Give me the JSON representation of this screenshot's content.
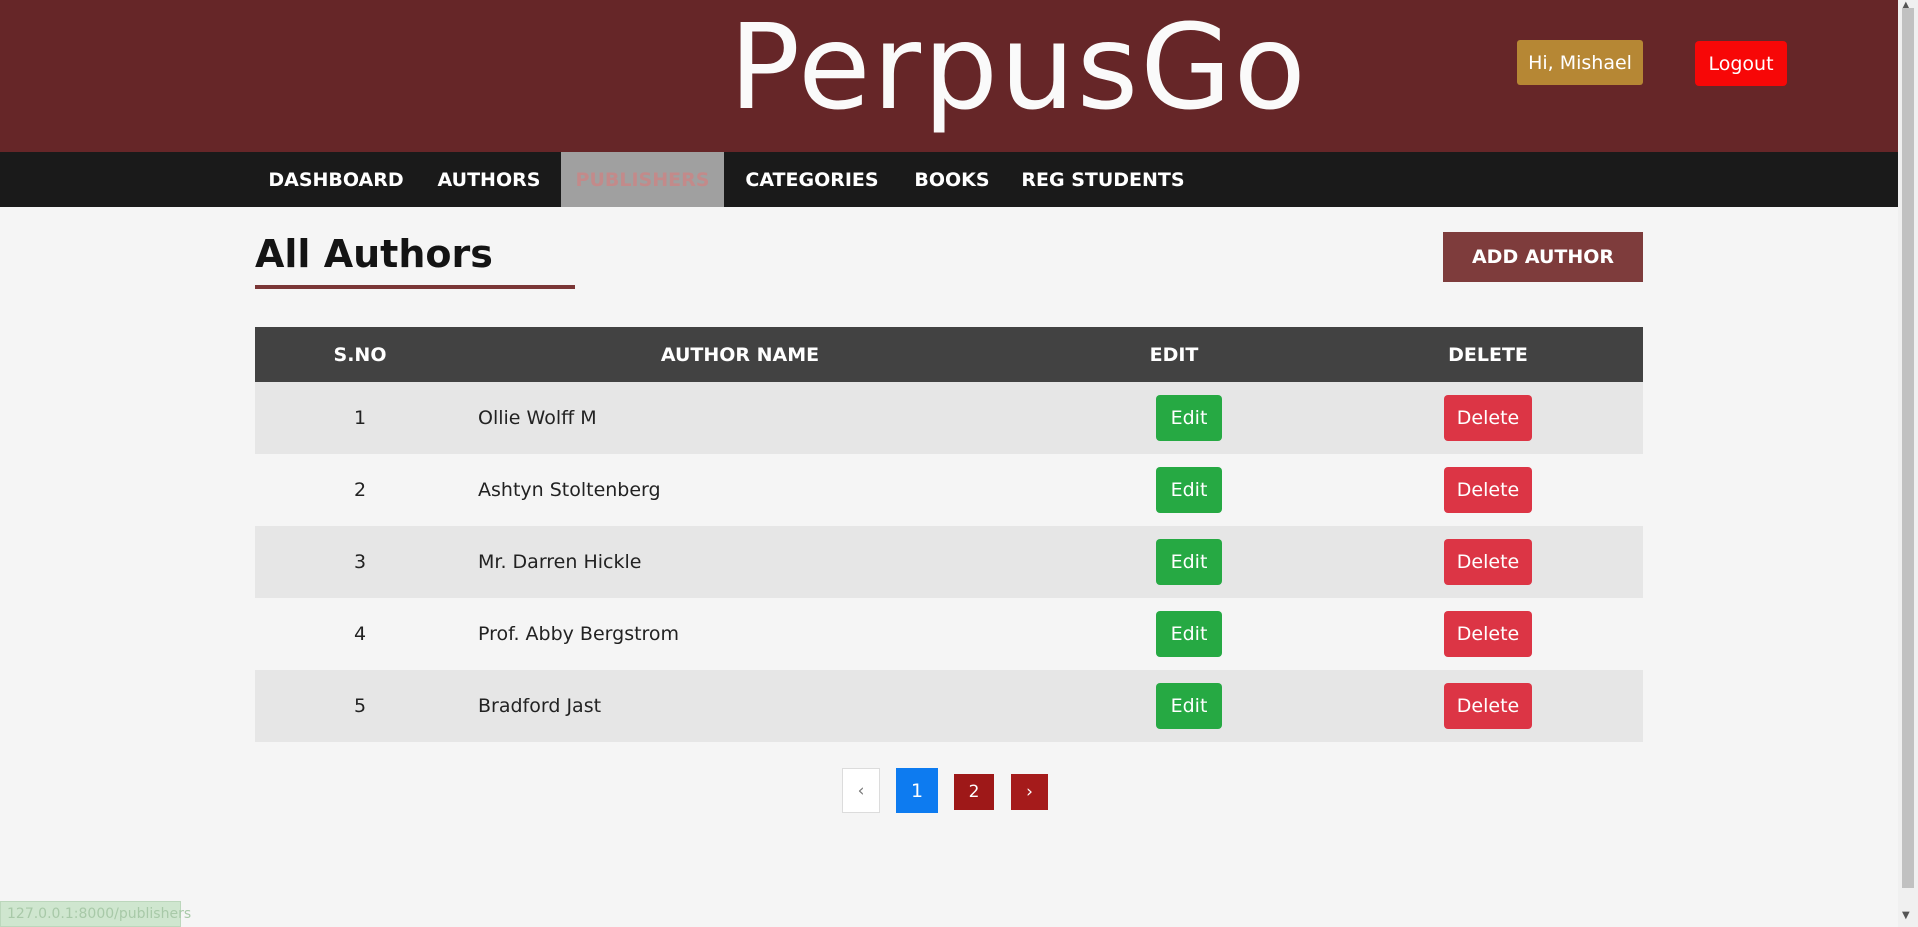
{
  "header": {
    "logo": "PerpusGo",
    "greeting": "Hi, Mishael",
    "logout_label": "Logout"
  },
  "nav": {
    "items": [
      {
        "label": "DASHBOARD"
      },
      {
        "label": "AUTHORS"
      },
      {
        "label": "PUBLISHERS"
      },
      {
        "label": "CATEGORIES"
      },
      {
        "label": "BOOKS"
      },
      {
        "label": "REG STUDENTS"
      }
    ]
  },
  "main": {
    "title": "All Authors",
    "add_label": "ADD AUTHOR",
    "columns": [
      "S.NO",
      "AUTHOR NAME",
      "EDIT",
      "DELETE"
    ],
    "rows": [
      {
        "sno": "1",
        "name": "Ollie Wolff M",
        "edit": "Edit",
        "delete": "Delete"
      },
      {
        "sno": "2",
        "name": "Ashtyn Stoltenberg",
        "edit": "Edit",
        "delete": "Delete"
      },
      {
        "sno": "3",
        "name": "Mr. Darren Hickle",
        "edit": "Edit",
        "delete": "Delete"
      },
      {
        "sno": "4",
        "name": "Prof. Abby Bergstrom",
        "edit": "Edit",
        "delete": "Delete"
      },
      {
        "sno": "5",
        "name": "Bradford Jast",
        "edit": "Edit",
        "delete": "Delete"
      }
    ]
  },
  "pagination": {
    "prev": "‹",
    "pages": [
      "1",
      "2"
    ],
    "next": "›"
  },
  "status_bar": {
    "url": "127.0.0.1:8000/publishers"
  },
  "colors": {
    "header_bg": "#662628",
    "nav_bg": "#1a1a1a",
    "edit_green": "#26a943",
    "delete_red": "#dc3545",
    "active_page_blue": "#0d7bf0"
  }
}
